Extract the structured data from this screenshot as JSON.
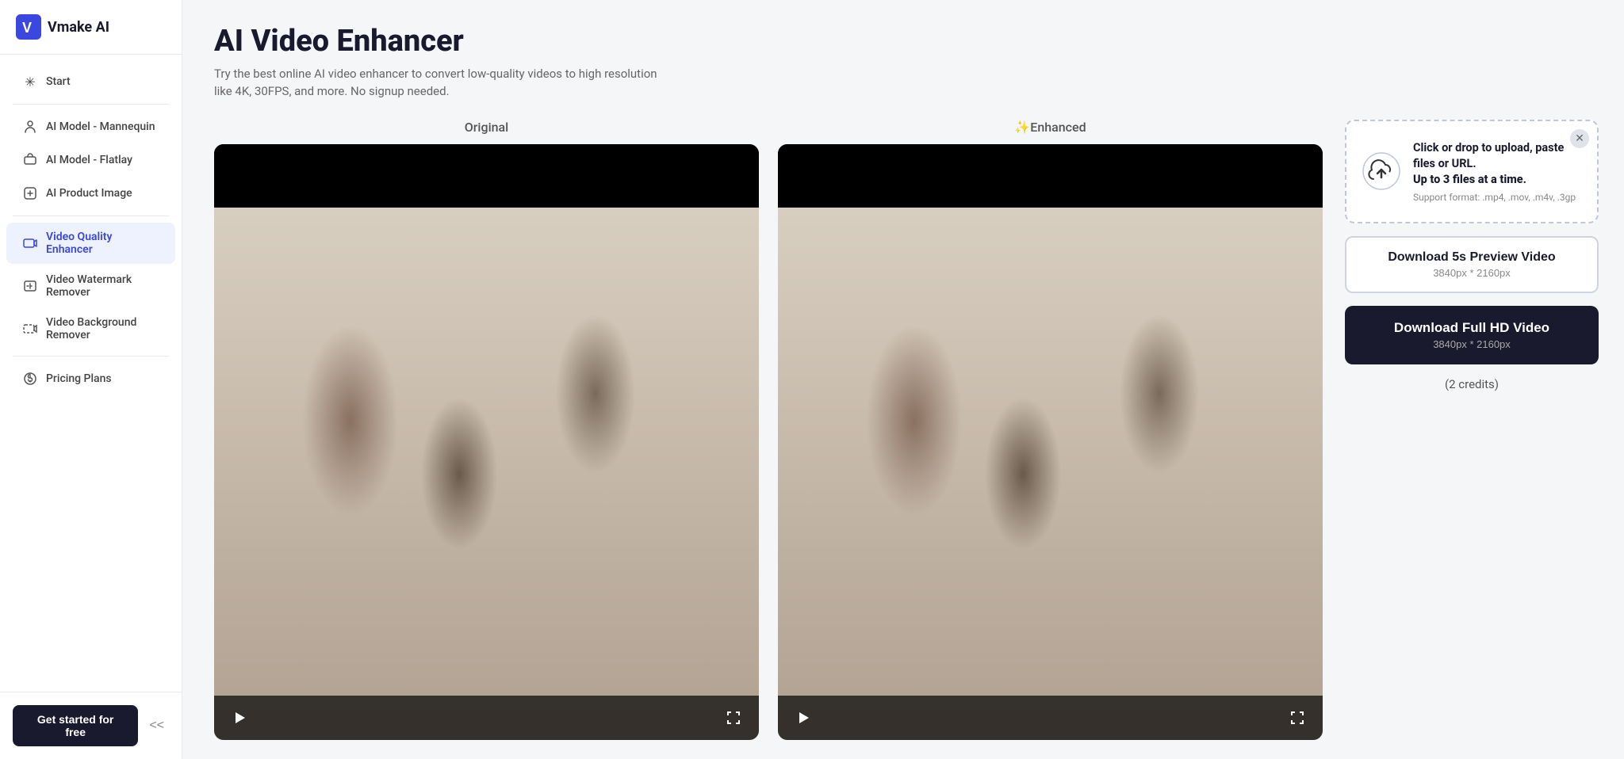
{
  "sidebar": {
    "logo": {
      "icon": "V",
      "text": "Vmake AI"
    },
    "nav_items": [
      {
        "id": "start",
        "label": "Start",
        "icon": "✳"
      },
      {
        "id": "ai-model-mannequin",
        "label": "AI Model - Mannequin",
        "icon": "🤖"
      },
      {
        "id": "ai-model-flatlay",
        "label": "AI Model - Flatlay",
        "icon": "👗"
      },
      {
        "id": "ai-product-image",
        "label": "AI Product Image",
        "icon": "🛍"
      },
      {
        "id": "video-quality-enhancer",
        "label": "Video Quality Enhancer",
        "icon": "🎬",
        "active": true
      },
      {
        "id": "video-watermark-remover",
        "label": "Video Watermark Remover",
        "icon": "🔲"
      },
      {
        "id": "video-background-remover",
        "label": "Video Background Remover",
        "icon": "🎞"
      },
      {
        "id": "pricing-plans",
        "label": "Pricing Plans",
        "icon": "💰"
      }
    ],
    "get_started_label": "Get started for free",
    "collapse_icon": "<<"
  },
  "main": {
    "title": "AI Video Enhancer",
    "subtitle": "Try the best online AI video enhancer to convert low-quality videos to high resolution like 4K, 30FPS, and more. No signup needed.",
    "video_original_label": "Original",
    "video_enhanced_label": "✨Enhanced",
    "upload": {
      "title": "Click or drop to upload, paste files or URL.",
      "subtitle": "Up to 3 files at a time.",
      "format": "Support format: .mp4, .mov, .m4v, .3gp"
    },
    "download_preview": {
      "label": "Download 5s Preview Video",
      "resolution": "3840px * 2160px"
    },
    "download_full": {
      "label": "Download Full HD Video",
      "resolution": "3840px * 2160px"
    },
    "credits": "(2 credits)"
  }
}
